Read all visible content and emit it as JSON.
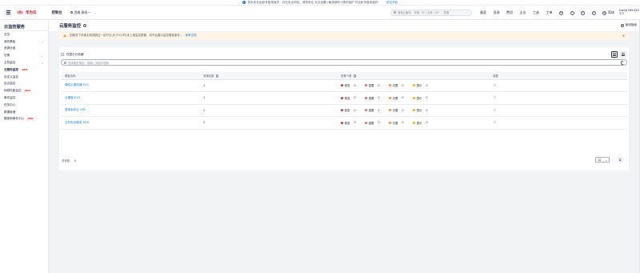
{
  "notice": {
    "text": "您尚未开启帐号登录保护，存在安全风险。请您前往 安全设置>敏感操作>操作保护 开启帐号登录保护。",
    "link": "前往开启"
  },
  "topbar": {
    "brand": "华为云",
    "console": "控制台",
    "region": "西南-贵阳一",
    "search_placeholder": "搜索云服务、资源（IP / 名称 / ID）、快捷",
    "nav": [
      "备案",
      "资源",
      "费用",
      "企业",
      "工具",
      "工单"
    ],
    "lang": "简体",
    "user_name": "hw04395435",
    "user_sub": "账号"
  },
  "sidebar": {
    "title": "云监控服务",
    "items": [
      {
        "label": "总览",
        "chevron": false,
        "badge": "",
        "active": false
      },
      {
        "label": "我的看板",
        "chevron": true,
        "badge": "",
        "active": false
      },
      {
        "label": "资源分组",
        "chevron": false,
        "badge": "",
        "active": false
      },
      {
        "label": "告警",
        "chevron": true,
        "badge": "",
        "active": false
      },
      {
        "label": "主机监控",
        "chevron": true,
        "badge": "",
        "active": false
      },
      {
        "label": "云服务监控",
        "chevron": false,
        "badge": "NEW",
        "active": true
      },
      {
        "label": "自定义监控",
        "chevron": false,
        "badge": "",
        "active": false
      },
      {
        "label": "站点监控",
        "chevron": false,
        "badge": "",
        "active": false
      },
      {
        "label": "网络性能监控",
        "chevron": false,
        "badge": "NEW",
        "active": false
      },
      {
        "label": "事件监控",
        "chevron": false,
        "badge": "",
        "active": false
      },
      {
        "label": "任务中心",
        "chevron": false,
        "badge": "",
        "active": false
      },
      {
        "label": "数据转储",
        "chevron": false,
        "badge": "",
        "active": false
      },
      {
        "label": "模型和事件中心",
        "chevron": false,
        "badge": "NEW",
        "active": false
      }
    ]
  },
  "page": {
    "title": "云服务监控",
    "guide": "使用指南",
    "warning": "如服务下未被实例或超过一定时长(大于3小时)未上报监控数据，将不会展示监控看板事件。",
    "warning_link": "参考文档",
    "toggle_label": "仅显示已收藏",
    "filter_placeholder": "选择属性筛选，或输入关键字搜索"
  },
  "table": {
    "headers": [
      "看板名称",
      "资源总数",
      "告警个数",
      "收藏"
    ],
    "alarm_levels": [
      {
        "label": "紧急",
        "color": "#e54545"
      },
      {
        "label": "重要",
        "color": "#f66f6a"
      },
      {
        "label": "次要",
        "color": "#fa9841"
      },
      {
        "label": "提示",
        "color": "#eeba18"
      }
    ],
    "rows": [
      {
        "name": "弹性云服务器 ECS",
        "count": "1",
        "alarms": [
          "0",
          "0",
          "0",
          "0"
        ]
      },
      {
        "name": "云硬盘 EVS",
        "count": "1",
        "alarms": [
          "0",
          "0",
          "0",
          "0"
        ]
      },
      {
        "name": "虚拟私有云 VPC",
        "count": "2",
        "alarms": [
          "0",
          "0",
          "0",
          "0"
        ]
      },
      {
        "name": "主机安全服务 HSS",
        "count": "2",
        "alarms": [
          "0",
          "0",
          "0",
          "0"
        ]
      }
    ]
  },
  "footer": {
    "total_label": "总条数：",
    "total": "4",
    "page_size": "10",
    "current_page": "1"
  }
}
